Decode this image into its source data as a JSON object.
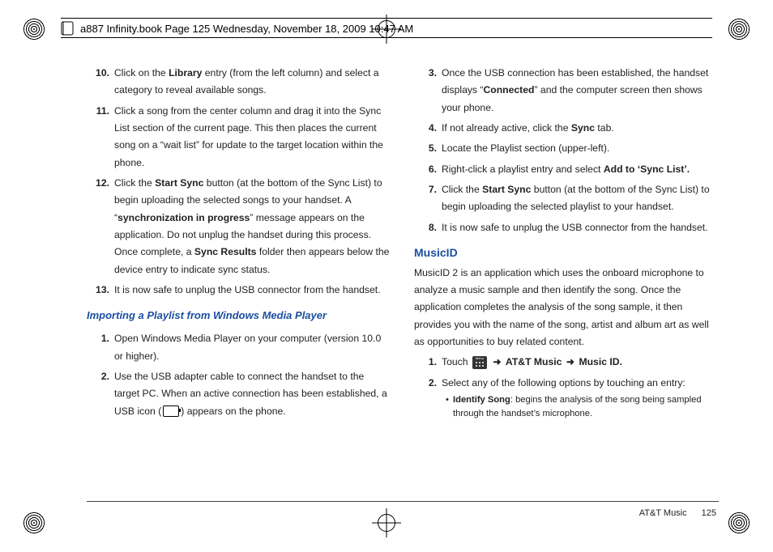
{
  "header": "a887 Infinity.book  Page 125  Wednesday, November 18, 2009  10:47 AM",
  "left": {
    "items": [
      {
        "n": "10.",
        "pre": "Click on the ",
        "b1": "Library",
        "post": " entry (from the left column) and select a category to reveal available songs."
      },
      {
        "n": "11.",
        "text": "Click a song from the center column and drag it into the Sync List section of the current page. This then places the current song on a “wait list” for update to the target location within the phone."
      },
      {
        "n": "12.",
        "pre": "Click the ",
        "b1": "Start Sync",
        "mid": " button (at the bottom of the Sync List) to begin uploading the selected songs to your handset. A “",
        "b2": "synchronization in progress",
        "mid2": "” message appears on the application. Do not unplug the handset during this process. Once complete, a ",
        "b3": "Sync Results",
        "post": " folder then appears below the device entry to indicate sync status."
      },
      {
        "n": "13.",
        "text": "It is now safe to unplug the USB connector from the handset."
      }
    ],
    "subhead": "Importing a Playlist from Windows Media Player",
    "sub_items": [
      {
        "n": "1.",
        "text": "Open Windows Media Player on your computer (version 10.0 or higher)."
      },
      {
        "n": "2.",
        "pre": "Use the USB adapter cable to connect the handset to the target PC. When an active connection has been established, a USB icon (",
        "post": ") appears on the phone."
      }
    ]
  },
  "right": {
    "items": [
      {
        "n": "3.",
        "pre": "Once the USB connection has been established, the handset displays “",
        "b1": "Connected",
        "post": "” and the computer screen then shows your phone."
      },
      {
        "n": "4.",
        "pre": "If not already active, click the ",
        "b1": "Sync",
        "post": " tab."
      },
      {
        "n": "5.",
        "text": "Locate the Playlist section (upper-left)."
      },
      {
        "n": "6.",
        "pre": "Right-click a playlist entry and select ",
        "b1": "Add to ‘Sync List’.",
        "post": ""
      },
      {
        "n": "7.",
        "pre": "Click the ",
        "b1": "Start Sync",
        "post": " button (at the bottom of the Sync List) to begin uploading the selected playlist to your handset."
      },
      {
        "n": "8.",
        "text": "It is now safe to unplug the USB connector from the handset."
      }
    ],
    "subhead": "MusicID",
    "para": "MusicID 2 is an application which uses the onboard microphone to analyze a music sample and then identify the song. Once the application completes the analysis of the song sample, it then provides you with the name of the song, artist and album art as well as opportunities to buy related content.",
    "m_items": [
      {
        "n": "1.",
        "pre": "Touch  ",
        "arrow": "➜",
        "b1": "AT&T Music",
        "arrow2": "➜",
        "b2": "Music ID.",
        "post": ""
      },
      {
        "n": "2.",
        "text": "Select any of the following options by touching an entry:"
      }
    ],
    "bullet": {
      "b": "Identify Song",
      "text": ": begins the analysis of the song being sampled through the handset’s microphone."
    }
  },
  "footer": {
    "section": "AT&T Music",
    "page": "125"
  }
}
